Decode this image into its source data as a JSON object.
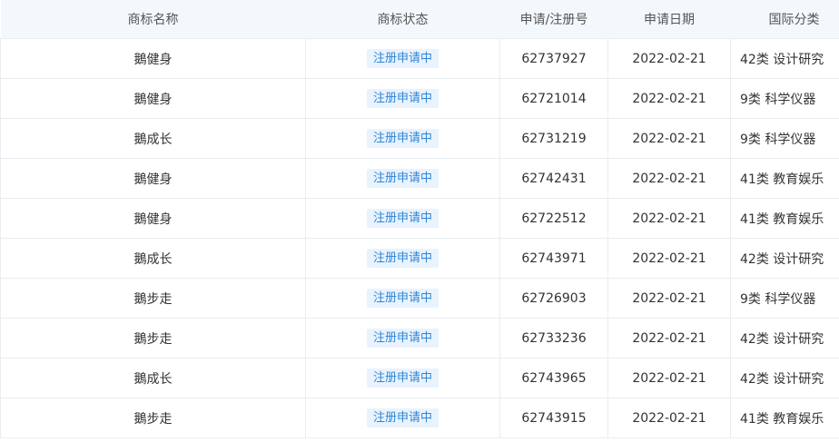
{
  "columns": {
    "name": "商标名称",
    "status": "商标状态",
    "reg_no": "申请/注册号",
    "date": "申请日期",
    "class": "国际分类"
  },
  "rows": [
    {
      "name": "鵝健身",
      "status": "注册申请中",
      "reg_no": "62737927",
      "date": "2022-02-21",
      "class": "42类 设计研究"
    },
    {
      "name": "鵝健身",
      "status": "注册申请中",
      "reg_no": "62721014",
      "date": "2022-02-21",
      "class": "9类 科学仪器"
    },
    {
      "name": "鵝成长",
      "status": "注册申请中",
      "reg_no": "62731219",
      "date": "2022-02-21",
      "class": "9类 科学仪器"
    },
    {
      "name": "鵝健身",
      "status": "注册申请中",
      "reg_no": "62742431",
      "date": "2022-02-21",
      "class": "41类 教育娱乐"
    },
    {
      "name": "鵝健身",
      "status": "注册申请中",
      "reg_no": "62722512",
      "date": "2022-02-21",
      "class": "41类 教育娱乐"
    },
    {
      "name": "鵝成长",
      "status": "注册申请中",
      "reg_no": "62743971",
      "date": "2022-02-21",
      "class": "42类 设计研究"
    },
    {
      "name": "鵝步走",
      "status": "注册申请中",
      "reg_no": "62726903",
      "date": "2022-02-21",
      "class": "9类 科学仪器"
    },
    {
      "name": "鵝步走",
      "status": "注册申请中",
      "reg_no": "62733236",
      "date": "2022-02-21",
      "class": "42类 设计研究"
    },
    {
      "name": "鵝成长",
      "status": "注册申请中",
      "reg_no": "62743965",
      "date": "2022-02-21",
      "class": "42类 设计研究"
    },
    {
      "name": "鵝步走",
      "status": "注册申请中",
      "reg_no": "62743915",
      "date": "2022-02-21",
      "class": "41类 教育娱乐"
    }
  ],
  "colors": {
    "header_bg": "#f3f8fc",
    "status_tag_bg": "#e8f3fe",
    "status_tag_text": "#2f86d6",
    "border": "#e9edf1"
  }
}
